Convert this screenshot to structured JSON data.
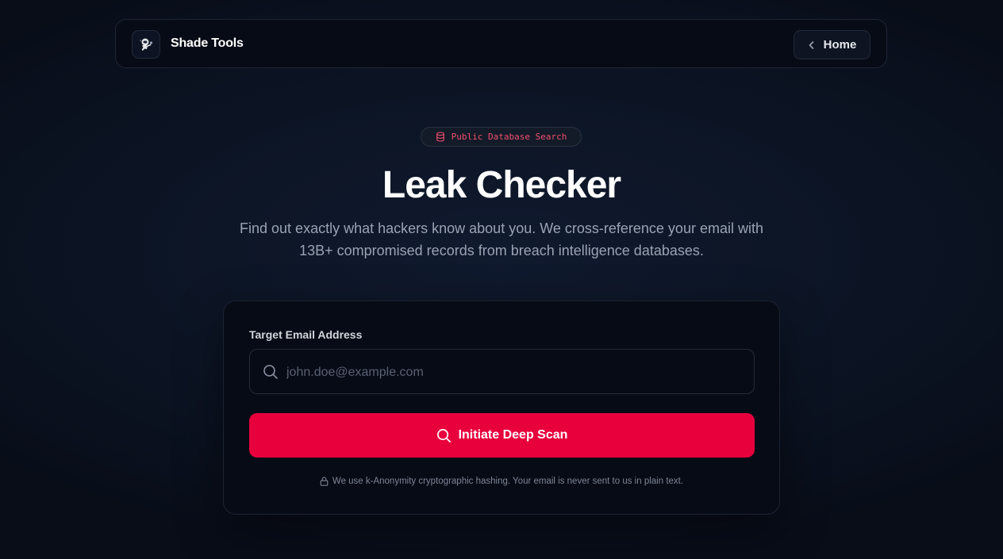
{
  "header": {
    "brand_name": "Shade Tools",
    "logo_icon": "astronaut-icon",
    "home_label": "Home",
    "home_icon": "chevron-left-icon"
  },
  "hero": {
    "badge_icon": "database-icon",
    "badge_text": "Public Database Search",
    "title": "Leak Checker",
    "subtitle": "Find out exactly what hackers know about you. We cross-reference your email with 13B+ compromised records from breach intelligence databases."
  },
  "form": {
    "field_label": "Target Email Address",
    "email_value": "",
    "email_placeholder": "john.doe@example.com",
    "search_icon": "search-icon",
    "scan_button_label": "Initiate Deep Scan",
    "privacy_icon": "lock-icon",
    "privacy_note": "We use k-Anonymity cryptographic hashing. Your email is never sent to us in plain text."
  },
  "colors": {
    "accent": "#e8003d",
    "badge_text": "#f0506e",
    "background": "#0b1120",
    "card": "#070b15",
    "muted_text": "#9aa3b2"
  }
}
